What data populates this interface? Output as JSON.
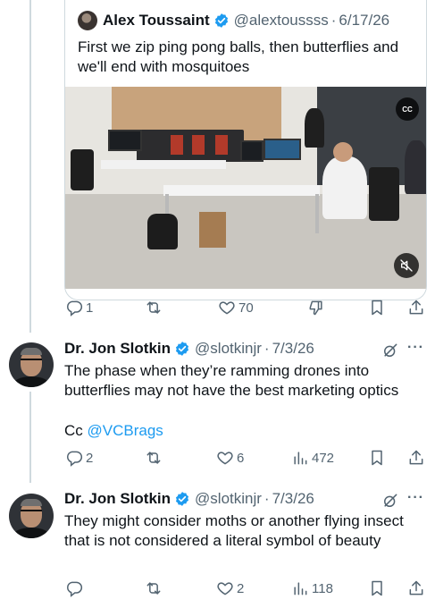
{
  "quoted_tweet": {
    "author_name": "Alex Toussaint",
    "handle": "@alextoussss",
    "separator": "·",
    "date": "6/17/26",
    "text": "First we zip ping pong balls, then butterflies and we'll end with mosquitoes",
    "video_badge": "CC",
    "video_muted": true,
    "stats": {
      "replies": "1",
      "reposts": "",
      "likes": "70"
    }
  },
  "replies": [
    {
      "author_name": "Dr. Jon Slotkin",
      "handle": "@slotkinjr",
      "separator": "·",
      "date": "7/3/26",
      "text": "The phase when they’re ramming drones into butterflies may not have the best marketing optics",
      "cc_prefix": "Cc ",
      "cc_mention": "@VCBrags",
      "stats": {
        "replies": "2",
        "reposts": "",
        "likes": "6",
        "views": "472"
      }
    },
    {
      "author_name": "Dr. Jon Slotkin",
      "handle": "@slotkinjr",
      "separator": "·",
      "date": "7/3/26",
      "text": "They might consider moths or another flying insect that is not considered a literal symbol of beauty",
      "stats": {
        "replies": "",
        "reposts": "",
        "likes": "2",
        "views": "118"
      }
    }
  ],
  "more_label": "···",
  "colors": {
    "text": "#0f1419",
    "secondary": "#536471",
    "verified": "#1d9bf0",
    "link": "#1d9bf0",
    "border": "#cfd9de"
  }
}
